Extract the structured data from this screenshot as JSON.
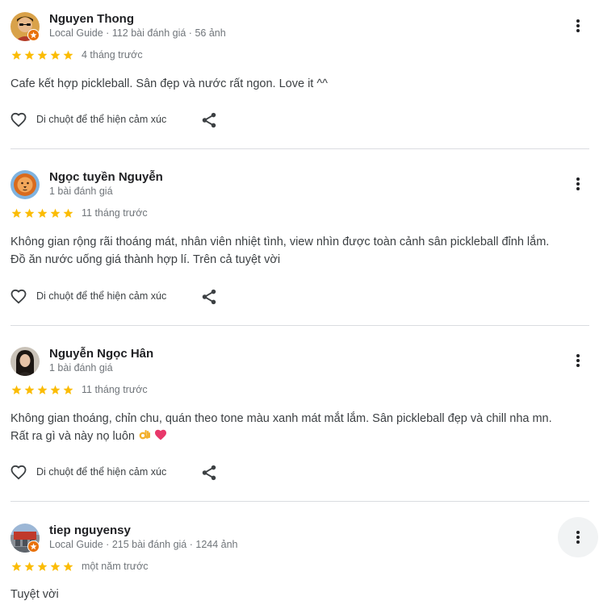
{
  "reviews": [
    {
      "name": "Nguyen Thong",
      "meta": "Local Guide · 112 bài đánh giá · 56 ảnh",
      "rating": 5,
      "date": "4 tháng trước",
      "text": "Cafe kết hợp pickleball. Sân đẹp và nước rất ngon. Love it ^^",
      "like_label": "Di chuột để thể hiện cảm xúc",
      "avatar_icon": "user-photo-avatar",
      "local_guide": true
    },
    {
      "name": "Ngọc tuyền Nguyễn",
      "meta": "1 bài đánh giá",
      "rating": 5,
      "date": "11 tháng trước",
      "text_lines": [
        "Không gian rộng rãi thoáng mát, nhân viên nhiệt tình, view nhìn được toàn cảnh sân pickleball đỉnh lắm.",
        "Đồ ăn nước uống giá thành hợp lí. Trên cả tuyệt vời"
      ],
      "like_label": "Di chuột để thể hiện cảm xúc",
      "avatar_icon": "lion-avatar",
      "local_guide": false
    },
    {
      "name": "Nguyễn Ngọc Hân",
      "meta": "1 bài đánh giá",
      "rating": 5,
      "date": "11 tháng trước",
      "text_lines": [
        "Không gian thoáng, chỉn chu, quán theo tone màu xanh mát mắt lắm. Sân pickleball đẹp và chill nha mn.",
        "Rất ra gì và này nọ luôn"
      ],
      "emojis": [
        "ok-hand-emoji",
        "heart-emoji"
      ],
      "like_label": "Di chuột để thể hiện cảm xúc",
      "avatar_icon": "user-photo-avatar",
      "local_guide": false
    },
    {
      "name": "tiep nguyensy",
      "meta": "Local Guide · 215 bài đánh giá · 1244 ảnh",
      "rating": 5,
      "date": "một năm trước",
      "text": "Tuyệt vời",
      "avatar_icon": "user-photo-avatar",
      "local_guide": true
    }
  ],
  "colors": {
    "star": "#fbbc04",
    "local_guide_badge": "#e8710a",
    "secondary_text": "#70757a",
    "divider": "#dadce0",
    "hover_background": "#f1f3f4"
  }
}
